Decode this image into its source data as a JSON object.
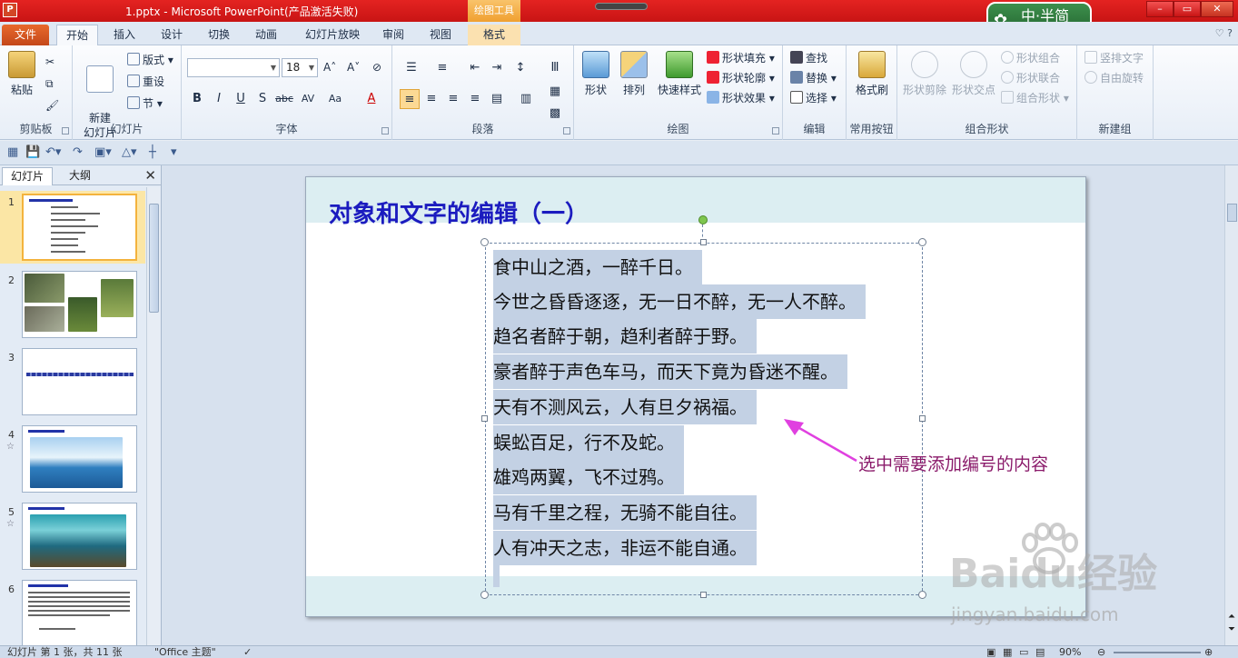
{
  "window": {
    "title": "1.pptx  -  Microsoft PowerPoint(产品激活失败)",
    "app_icon": "P",
    "contextual_tab": "绘图工具",
    "minimize": "–",
    "restore": "▭",
    "close": "✕",
    "ime_label": "中·半简"
  },
  "tabs": [
    {
      "label": "文件"
    },
    {
      "label": "开始"
    },
    {
      "label": "插入"
    },
    {
      "label": "设计"
    },
    {
      "label": "切换"
    },
    {
      "label": "动画"
    },
    {
      "label": "幻灯片放映"
    },
    {
      "label": "审阅"
    },
    {
      "label": "视图"
    },
    {
      "label": "格式"
    }
  ],
  "tabs_right": "♡ ?",
  "ribbon": {
    "clipboard": {
      "label": "剪贴板",
      "paste": "粘贴"
    },
    "slides": {
      "label": "幻灯片",
      "new_slide": "新建\n幻灯片",
      "layout": "版式",
      "reset": "重设",
      "section": "节"
    },
    "font": {
      "label": "字体",
      "font_name": "",
      "font_size": "18"
    },
    "paragraph": {
      "label": "段落"
    },
    "drawing": {
      "label": "绘图",
      "shapes": "形状",
      "arrange": "排列",
      "quick_styles": "快速样式",
      "fill": "形状填充",
      "outline": "形状轮廓",
      "effects": "形状效果"
    },
    "editing": {
      "label": "编辑",
      "find": "查找",
      "replace": "替换",
      "select": "选择"
    },
    "common": {
      "label": "常用按钮",
      "format_painter": "格式刷"
    },
    "merge": {
      "label": "组合形状",
      "subtract": "形状剪除",
      "intersect": "形状交点",
      "combine": "形状组合",
      "union": "形状联合",
      "group": "组合形状"
    },
    "newgroup": {
      "label": "新建组",
      "vertical": "竖排文字",
      "rotate": "自由旋转"
    }
  },
  "panel": {
    "tab_slides": "幻灯片",
    "tab_outline": "大纲",
    "close": "✕",
    "thumbnails": [
      {
        "num": "1"
      },
      {
        "num": "2"
      },
      {
        "num": "3"
      },
      {
        "num": "4"
      },
      {
        "num": "5"
      },
      {
        "num": "6"
      }
    ]
  },
  "slide": {
    "title": "对象和文字的编辑（一）",
    "lines": [
      "食中山之酒，一醉千日。",
      "今世之昏昏逐逐，无一日不醉，无一人不醉。",
      "趋名者醉于朝，趋利者醉于野。",
      "豪者醉于声色车马，而天下竟为昏迷不醒。",
      "天有不测风云，人有旦夕祸福。",
      "蜈蚣百足，行不及蛇。",
      "雄鸡两翼，飞不过鸦。",
      "马有千里之程，无骑不能自往。",
      "人有冲天之志，非运不能自通。"
    ]
  },
  "annotation": "选中需要添加编号的内容",
  "status": {
    "slide_info": "幻灯片 第 1 张，共 11 张",
    "theme": "\"Office 主题\"",
    "zoom": "90%"
  },
  "watermark": {
    "brand": "Baidu经验",
    "url": "jingyan.baidu.com"
  },
  "colors": {
    "accent": "#c81414",
    "title": "#1b1bbf",
    "selection": "#c3d1e4",
    "annotation": "#8a1a6a",
    "arrow": "#e040e0"
  }
}
